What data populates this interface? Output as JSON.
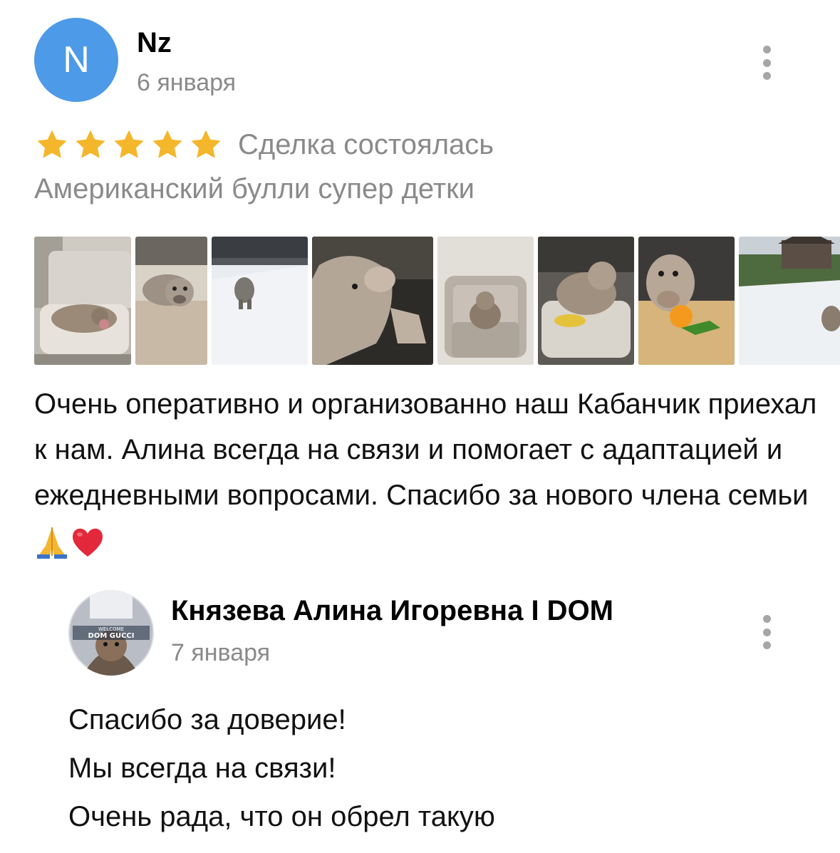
{
  "review": {
    "author_initial": "N",
    "author_name": "Nz",
    "date": "6 января",
    "rating": 5,
    "rating_max": 5,
    "deal_status": "Сделка состоялась",
    "ad_title": "Американский булли супер детки",
    "photos": [
      {
        "name": "photo-dog-on-sofa-bed"
      },
      {
        "name": "photo-dog-lying-on-floor"
      },
      {
        "name": "photo-dog-in-snow"
      },
      {
        "name": "photo-dog-closeup-profile"
      },
      {
        "name": "photo-dog-in-armchair"
      },
      {
        "name": "photo-dog-on-dog-bed"
      },
      {
        "name": "photo-dog-with-orange"
      },
      {
        "name": "photo-dog-snowy-yard"
      }
    ],
    "text": "Очень оперативно и организованно наш Кабанчик приехал к нам. Алина всегда на связи и помогает с адаптацией и ежедневными вопросами. Спасибо за нового члена семьи",
    "emojis": [
      "pray-icon",
      "heart-icon"
    ],
    "colors": {
      "avatar": "#4d9ae8",
      "star": "#f4b72b",
      "muted": "#8a8a8a"
    }
  },
  "reply": {
    "author_name": "Князева Алина Игоревна I DOM",
    "date": "7 января",
    "avatar_text_top": "WELCOME",
    "avatar_text_main": "DOM GUCCI",
    "lines": [
      "Спасибо за доверие!",
      "Мы всегда на связи!",
      "Очень рада, что он обрел такую"
    ]
  }
}
